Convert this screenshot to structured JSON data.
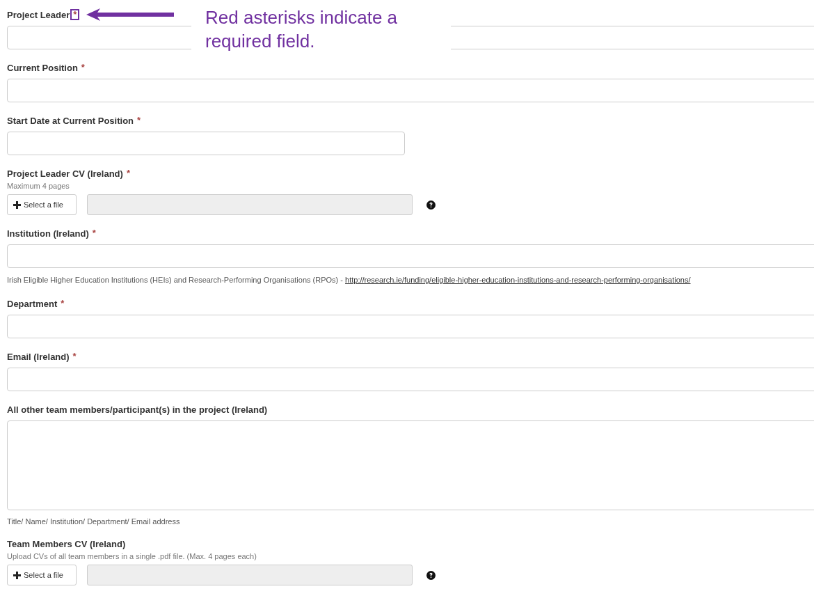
{
  "fields": [
    {
      "kind": "text",
      "label": "Project Leader",
      "asterisk": "*",
      "highlighted": true
    },
    {
      "kind": "text",
      "label": "Current Position",
      "asterisk": "*",
      "highlighted": false
    },
    {
      "kind": "date",
      "label": "Start Date at Current Position",
      "asterisk": "*",
      "highlighted": false
    },
    {
      "kind": "file",
      "label": "Project Leader CV (Ireland)",
      "asterisk": "*",
      "highlighted": false,
      "note": "Maximum 4 pages",
      "button": "Select a file"
    },
    {
      "kind": "select",
      "label": "Institution (Ireland)",
      "asterisk": "*",
      "highlighted": false,
      "help": "Irish Eligible Higher Education Institutions (HEIs) and Research-Performing Organisations (RPOs) - ",
      "link": "http://research.ie/funding/eligible-higher-education-institutions-and-research-performing-organisations/"
    },
    {
      "kind": "text",
      "label": "Department",
      "asterisk": "*",
      "highlighted": false
    },
    {
      "kind": "text",
      "label": "Email (Ireland)",
      "asterisk": "*",
      "highlighted": false
    },
    {
      "kind": "textarea",
      "label": "All other team members/participant(s) in the project (Ireland)",
      "help": "Title/ Name/ Institution/ Department/ Email address"
    },
    {
      "kind": "file",
      "label": "Team Members CV (Ireland)",
      "note": "Upload CVs of all team members in a single .pdf file. (Max. 4 pages each)",
      "button": "Select a file"
    }
  ],
  "annotation": {
    "text": "Red asterisks indicate a required field."
  }
}
